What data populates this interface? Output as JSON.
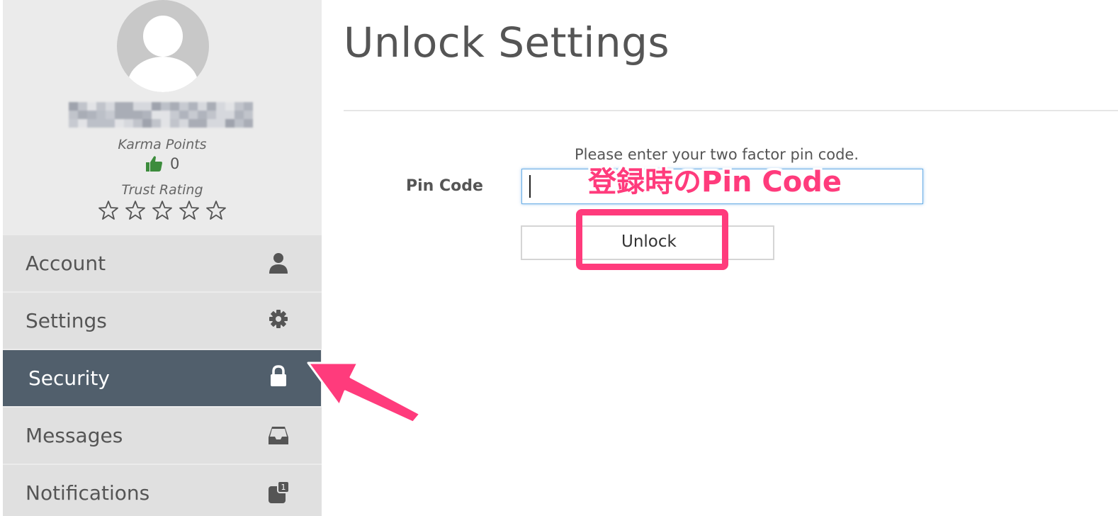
{
  "profile": {
    "karma_label": "Karma Points",
    "karma_value": "0",
    "trust_label": "Trust Rating",
    "trust_stars_filled": 0,
    "trust_stars_total": 5
  },
  "sidebar": {
    "items": [
      {
        "label": "Account",
        "icon": "user-icon",
        "active": false
      },
      {
        "label": "Settings",
        "icon": "gear-icon",
        "active": false
      },
      {
        "label": "Security",
        "icon": "lock-icon",
        "active": true
      },
      {
        "label": "Messages",
        "icon": "inbox-icon",
        "active": false
      },
      {
        "label": "Notifications",
        "icon": "notification-badge-icon",
        "badge": "1",
        "active": false
      }
    ]
  },
  "main": {
    "title": "Unlock Settings",
    "instruction": "Please enter your two factor pin code.",
    "pin_label": "Pin Code",
    "pin_value": "",
    "unlock_label": "Unlock"
  },
  "annotation": {
    "text": "登録時のPin Code",
    "color": "#ff3b7c"
  },
  "colors": {
    "sidebar_bg": "#ebebeb",
    "menu_item_bg": "#e0e0e0",
    "active_item_bg": "#515f6c",
    "input_focus": "#6aaee6",
    "thumb_green": "#3c8c3c"
  }
}
